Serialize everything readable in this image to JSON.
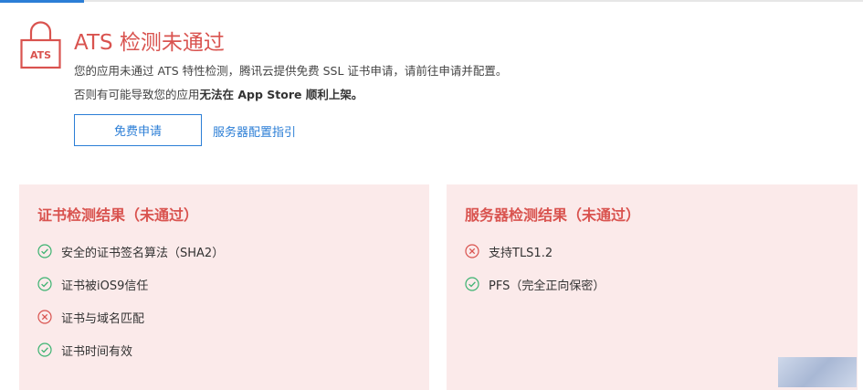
{
  "header": {
    "lock_text": "ATS",
    "title": "ATS 检测未通过",
    "desc_line1": "您的应用未通过 ATS 特性检测，腾讯云提供免费 SSL 证书申请，请前往申请并配置。",
    "desc_line2_prefix": "否则有可能导致您的应用",
    "desc_line2_bold": "无法在 App Store 顺利上架。"
  },
  "actions": {
    "apply_label": "免费申请",
    "guide_label": "服务器配置指引"
  },
  "cert_panel": {
    "title": "证书检测结果（未通过）",
    "items": [
      {
        "label": "安全的证书签名算法（SHA2）",
        "status": "pass"
      },
      {
        "label": "证书被iOS9信任",
        "status": "pass"
      },
      {
        "label": "证书与域名匹配",
        "status": "fail"
      },
      {
        "label": "证书时间有效",
        "status": "pass"
      }
    ]
  },
  "server_panel": {
    "title": "服务器检测结果（未通过）",
    "items": [
      {
        "label": "支持TLS1.2",
        "status": "fail"
      },
      {
        "label": "PFS（完全正向保密）",
        "status": "pass"
      }
    ]
  },
  "watermark": {
    "text": "风流少年"
  },
  "colors": {
    "error": "#d9534f",
    "pass": "#3cb371",
    "link": "#2b7ed6",
    "panel_bg": "#fbeaea"
  }
}
